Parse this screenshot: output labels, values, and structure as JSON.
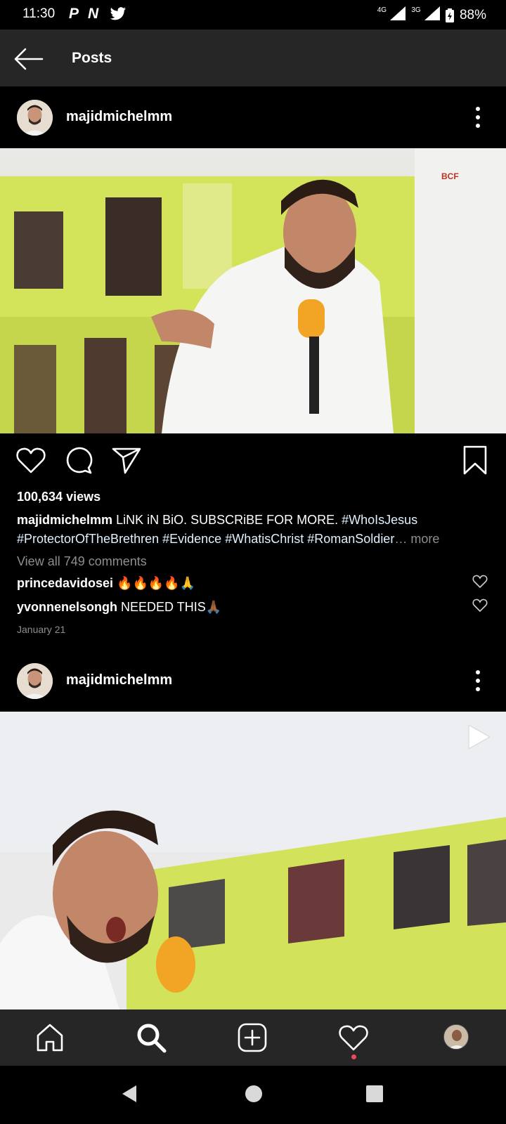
{
  "status_bar": {
    "time": "11:30",
    "notification_apps": "P N",
    "network_1": "4G",
    "network_2": "3G",
    "battery": "88%"
  },
  "app_bar": {
    "title": "Posts"
  },
  "post1": {
    "username": "majidmichelmm",
    "views": "100,634 views",
    "caption_user": "majidmichelmm",
    "caption_text": "LiNK iN BiO. SUBSCRiBE FOR MORE.",
    "caption_tag1": "#WhoIsJesus",
    "caption_tag2": "#ProtectorOfTheBrethren",
    "caption_tag3": "#Evidence",
    "caption_tag4": "#WhatisChrist",
    "caption_tag5": "#RomanSoldier",
    "caption_ellipsis": "…",
    "more": "more",
    "view_comments": "View all 749 comments",
    "comments": [
      {
        "user": "princedavidosei",
        "text": "🔥🔥🔥🔥🙏"
      },
      {
        "user": "yvonnenelsongh",
        "text": "NEEDED THIS🙏🏾"
      }
    ],
    "date": "January 21",
    "image_logo": "BCF"
  },
  "post2": {
    "username": "majidmichelmm"
  },
  "icons": {
    "like": "heart-icon",
    "comment": "comment-icon",
    "share": "paper-plane-icon",
    "save": "bookmark-icon",
    "home": "home-icon",
    "search": "search-icon",
    "add": "add-post-icon",
    "activity": "heart-icon",
    "video": "play-icon"
  },
  "colors": {
    "background": "#000000",
    "bar": "#262626",
    "secondary_text": "#8e8e8e",
    "hashtag": "#e0f1ff",
    "notification_dot": "#ed4956"
  }
}
